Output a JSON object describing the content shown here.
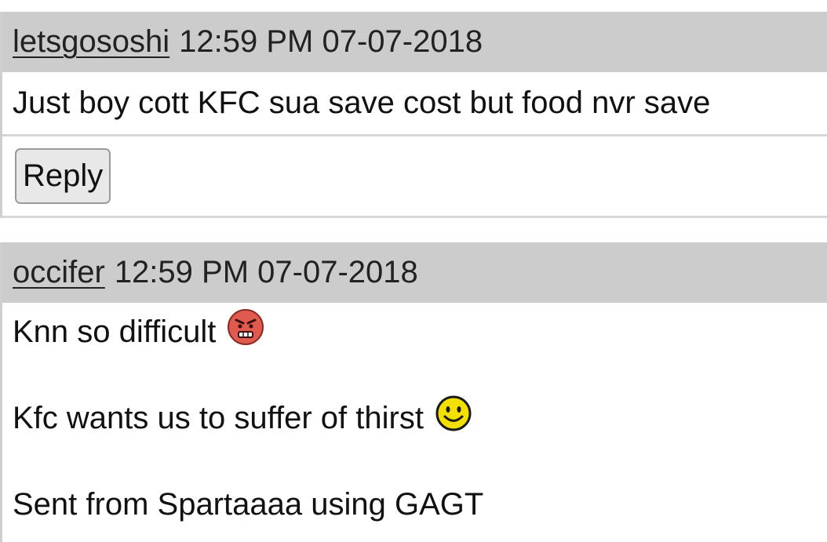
{
  "posts": [
    {
      "username": "letsgososhi",
      "timestamp": "12:59 PM 07-07-2018",
      "body": "Just boy cott KFC sua save cost but food nvr save",
      "reply_label": "Reply"
    },
    {
      "username": "occifer",
      "timestamp": "12:59 PM 07-07-2018",
      "lines": [
        {
          "text": "Knn so difficult",
          "icon": "angry-face-icon"
        },
        {
          "text": "Kfc wants us to suffer of thirst",
          "icon": "smiley-face-icon"
        },
        {
          "text": "Sent from Spartaaaa using GAGT"
        }
      ]
    }
  ],
  "colors": {
    "header_bg": "#cccccc",
    "angry_face": "#e05a50",
    "smiley_face": "#f4e000"
  }
}
